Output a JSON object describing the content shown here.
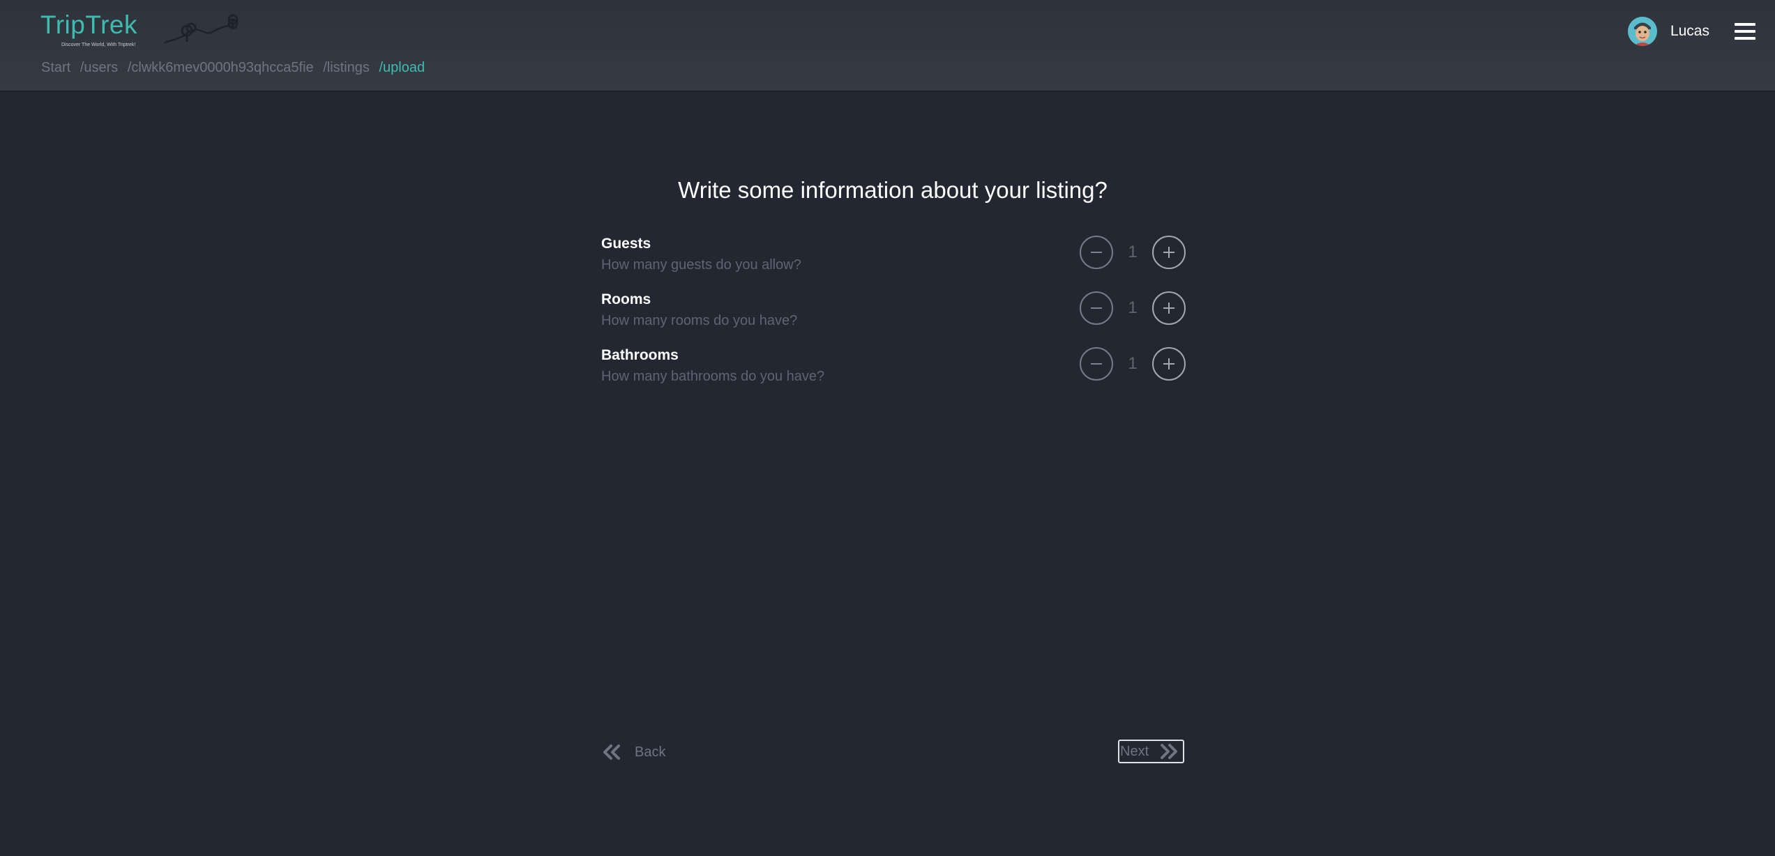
{
  "app": {
    "name": "TripTrek",
    "tagline": "Discover The World, With Triptrek!"
  },
  "breadcrumb": [
    "Start",
    "/users",
    "/clwkk6mev0000h93qhcca5fie",
    "/listings",
    "/upload"
  ],
  "user": {
    "name": "Lucas"
  },
  "page": {
    "title": "Write some information about your listing?"
  },
  "counters": {
    "guests": {
      "label": "Guests",
      "description": "How many guests do you allow?",
      "value": "1"
    },
    "rooms": {
      "label": "Rooms",
      "description": "How many rooms do you have?",
      "value": "1"
    },
    "bathrooms": {
      "label": "Bathrooms",
      "description": "How many bathrooms do you have?",
      "value": "1"
    }
  },
  "nav": {
    "back_label": "Back",
    "next_label": "Next"
  },
  "colors": {
    "accent": "#3fbcb0",
    "background": "#222731",
    "header": "#353943"
  },
  "icons": [
    "menu-icon",
    "avatar",
    "minus-icon",
    "plus-icon",
    "double-chevron-left-icon",
    "double-chevron-right-icon"
  ]
}
